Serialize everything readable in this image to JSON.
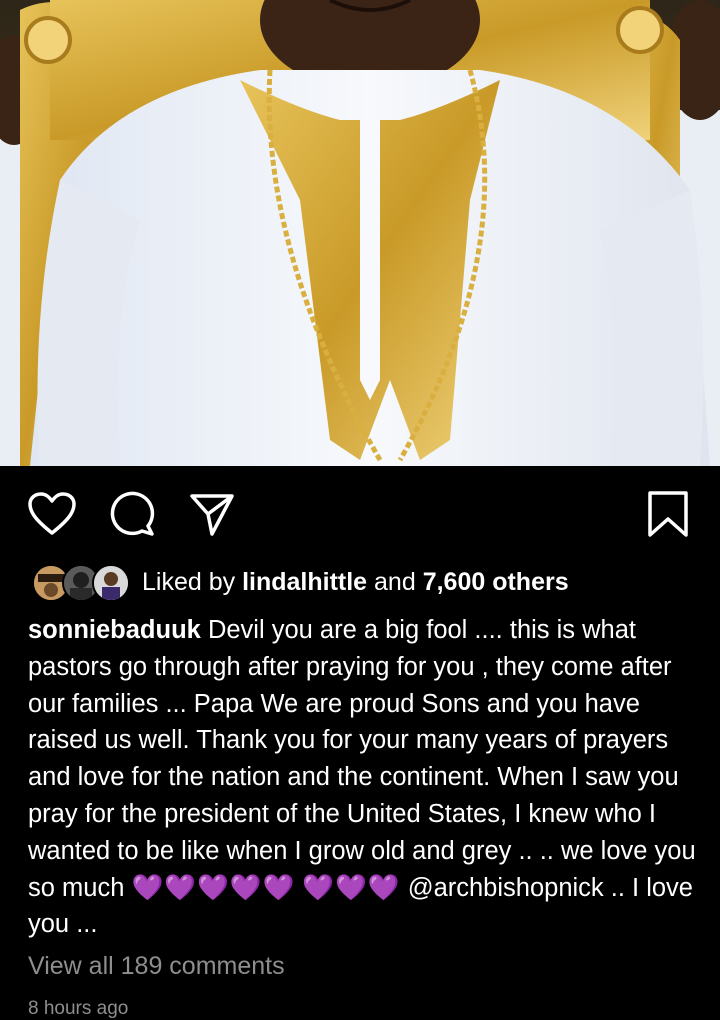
{
  "post": {
    "image_alt_subject": "",
    "liked_by_prefix": "Liked by",
    "liked_by_user": "lindalhittle",
    "liked_by_and": "and",
    "liked_by_others": "7,600 others",
    "author": "sonniebaduuk",
    "caption_text": "Devil you are a big fool .... this is what pastors go through after praying for you , they come after our families ... Papa We are proud Sons and you have raised us well. Thank you for your many years of prayers and love for the nation and the continent. When I saw you pray for the president of the United States, I knew who I wanted to be like when I grow old and grey .. .. we love you so much",
    "hearts_line1": "💜💜💜💜💜",
    "hearts_line2": "💜💜💜",
    "mention": "@archbishopnick",
    "caption_tail": ".. I love you ...",
    "view_comments": "View all 189 comments",
    "timestamp": "8 hours ago"
  },
  "icons": {
    "like": "heart-outline-icon",
    "comment": "comment-bubble-icon",
    "share": "paper-plane-icon",
    "save": "bookmark-icon"
  },
  "colors": {
    "background": "#000000",
    "text": "#ffffff",
    "secondary_text": "#8e8e8e",
    "heart_emoji": "#8a2be2"
  }
}
